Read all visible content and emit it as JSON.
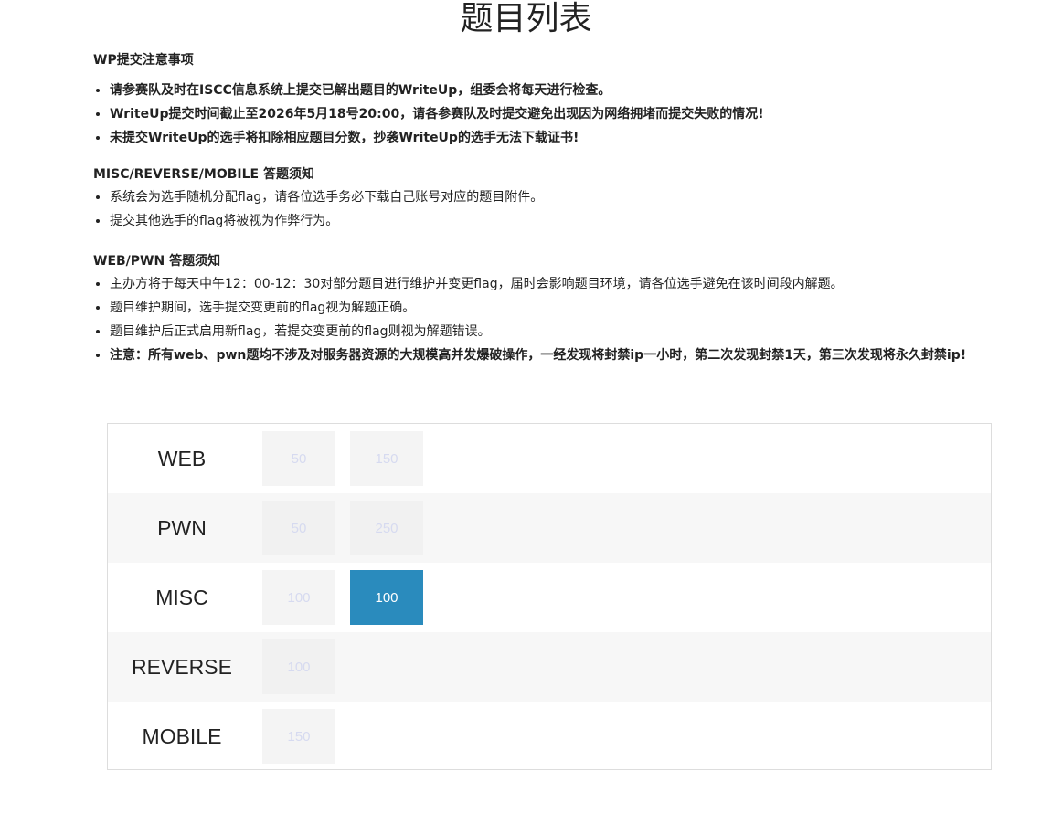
{
  "page": {
    "title": "题目列表"
  },
  "sections": [
    {
      "heading": "WP提交注意事项",
      "items": [
        "请参赛队及时在ISCC信息系统上提交已解出题目的WriteUp，组委会将每天进行检查。",
        "WriteUp提交时间截止至2026年5月18号20:00，请各参赛队及时提交避免出现因为网络拥堵而提交失败的情况!",
        "未提交WriteUp的选手将扣除相应题目分数，抄袭WriteUp的选手无法下载证书!"
      ]
    },
    {
      "heading": "MISC/REVERSE/MOBILE 答题须知",
      "items": [
        "系统会为选手随机分配flag，请各位选手务必下载自己账号对应的题目附件。",
        "提交其他选手的flag将被视为作弊行为。"
      ]
    },
    {
      "heading": "WEB/PWN 答题须知",
      "items": [
        "主办方将于每天中午12：00-12：30对部分题目进行维护并变更flag，届时会影响题目环境，请各位选手避免在该时间段内解题。",
        "题目维护期间，选手提交变更前的flag视为解题正确。",
        "题目维护后正式启用新flag，若提交变更前的flag则视为解题错误。",
        "注意：所有web、pwn题均不涉及对服务器资源的大规模高并发爆破操作，一经发现将封禁ip一小时，第二次发现封禁1天，第三次发现将永久封禁ip!"
      ]
    }
  ],
  "categories": [
    {
      "name": "WEB",
      "challenges": [
        {
          "points": "50",
          "solved": false
        },
        {
          "points": "150",
          "solved": false
        }
      ]
    },
    {
      "name": "PWN",
      "challenges": [
        {
          "points": "50",
          "solved": false
        },
        {
          "points": "250",
          "solved": false
        }
      ]
    },
    {
      "name": "MISC",
      "challenges": [
        {
          "points": "100",
          "solved": false
        },
        {
          "points": "100",
          "solved": true
        }
      ]
    },
    {
      "name": "REVERSE",
      "challenges": [
        {
          "points": "100",
          "solved": false
        }
      ]
    },
    {
      "name": "MOBILE",
      "challenges": [
        {
          "points": "150",
          "solved": false
        }
      ]
    }
  ],
  "colors": {
    "solved_bg": "#2a8bbd",
    "unsolved_bg": "#f4f4f4",
    "unsolved_text": "#d6daf0"
  }
}
